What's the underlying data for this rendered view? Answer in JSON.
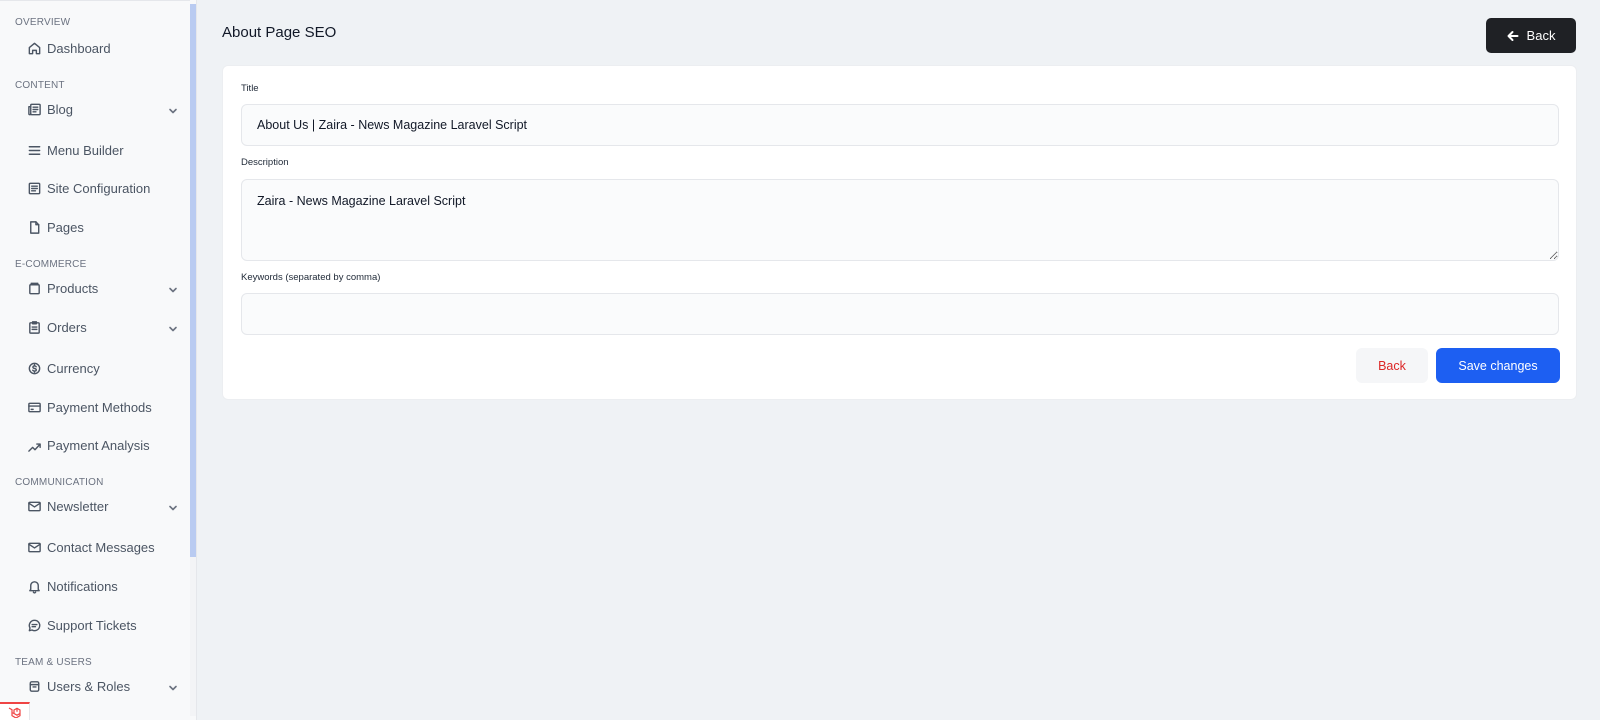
{
  "sidebar": {
    "sections": [
      {
        "title": "OVERVIEW",
        "items": [
          {
            "label": "Dashboard",
            "icon": "home-icon",
            "chevron": false
          }
        ]
      },
      {
        "title": "CONTENT",
        "items": [
          {
            "label": "Blog",
            "icon": "newspaper-icon",
            "chevron": true
          },
          {
            "label": "Menu Builder",
            "icon": "menu-icon",
            "chevron": false
          },
          {
            "label": "Site Configuration",
            "icon": "list-icon",
            "chevron": false
          },
          {
            "label": "Pages",
            "icon": "file-icon",
            "chevron": false
          }
        ]
      },
      {
        "title": "E-COMMERCE",
        "items": [
          {
            "label": "Products",
            "icon": "box-icon",
            "chevron": true
          },
          {
            "label": "Orders",
            "icon": "clipboard-icon",
            "chevron": true
          },
          {
            "label": "Currency",
            "icon": "currency-icon",
            "chevron": false
          },
          {
            "label": "Payment Methods",
            "icon": "credit-card-icon",
            "chevron": false
          },
          {
            "label": "Payment Analysis",
            "icon": "chart-icon",
            "chevron": false
          }
        ]
      },
      {
        "title": "COMMUNICATION",
        "items": [
          {
            "label": "Newsletter",
            "icon": "mail-icon",
            "chevron": true
          },
          {
            "label": "Contact Messages",
            "icon": "mail-icon",
            "chevron": false
          },
          {
            "label": "Notifications",
            "icon": "bell-icon",
            "chevron": false
          },
          {
            "label": "Support Tickets",
            "icon": "chat-icon",
            "chevron": false
          }
        ]
      },
      {
        "title": "TEAM & USERS",
        "items": [
          {
            "label": "Users & Roles",
            "icon": "archive-icon",
            "chevron": true
          }
        ]
      }
    ]
  },
  "header": {
    "title": "About Page SEO",
    "back_label": "Back"
  },
  "form": {
    "title_label": "Title",
    "title_value": "About Us | Zaira - News Magazine Laravel Script",
    "description_label": "Description",
    "description_value": "Zaira - News Magazine Laravel Script",
    "keywords_label": "Keywords (separated by comma)",
    "keywords_value": "",
    "back_label": "Back",
    "save_label": "Save changes"
  },
  "colors": {
    "accent": "#1d5ff2",
    "danger": "#dc2626",
    "dark_button": "#1f2125"
  }
}
